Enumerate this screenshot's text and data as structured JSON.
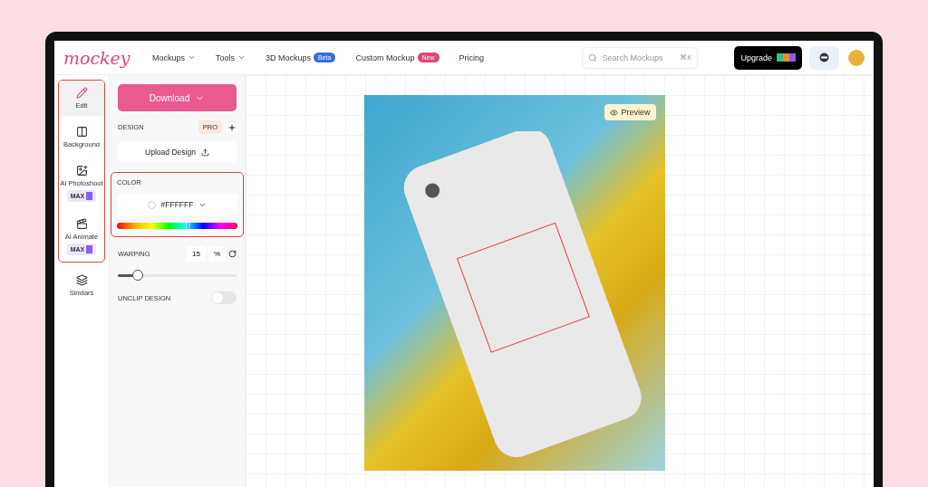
{
  "header": {
    "logo": "mockey",
    "nav": [
      {
        "label": "Mockups",
        "dropdown": true
      },
      {
        "label": "Tools",
        "dropdown": true
      },
      {
        "label": "3D Mockups",
        "badge": "Beta",
        "color": "#2f6fe0"
      },
      {
        "label": "Custom Mockup",
        "badge": "New",
        "color": "#e0457b"
      },
      {
        "label": "Pricing"
      }
    ],
    "search": {
      "placeholder": "Search Mockups",
      "shortcut": "⌘K"
    },
    "upgrade": "Upgrade"
  },
  "sidebar": {
    "items": [
      {
        "label": "Edit",
        "selected": true,
        "highlighted": true
      },
      {
        "label": "Background",
        "selected": false,
        "highlighted": true
      },
      {
        "label": "AI Photoshoot",
        "selected": false,
        "highlighted": true,
        "badge": "MAX"
      },
      {
        "label": "AI Animate",
        "selected": false,
        "highlighted": true,
        "badge": "MAX"
      },
      {
        "label": "Similars",
        "selected": false,
        "highlighted": false
      }
    ]
  },
  "panel": {
    "download": "Download",
    "design": {
      "label": "DESIGN",
      "pro": "PRO",
      "upload": "Upload Design"
    },
    "color": {
      "label": "COLOR",
      "value": "#FFFFFF",
      "level": 0.58,
      "highlighted": true
    },
    "warping": {
      "label": "WARPING",
      "value": "15",
      "unit": "%",
      "level": 0.17
    },
    "unclip": {
      "label": "UNCLIP DESIGN",
      "on": false
    }
  },
  "canvas": {
    "preview": "Preview"
  }
}
